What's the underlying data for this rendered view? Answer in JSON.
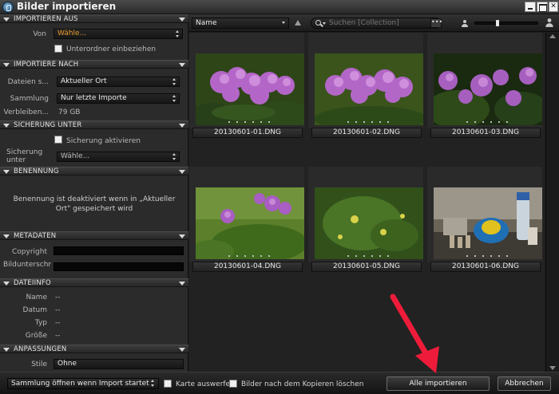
{
  "window": {
    "title": "Bilder importieren"
  },
  "left_panel": {
    "sections": {
      "importieren_aus": "IMPORTIEREN AUS",
      "importiere_nach": "IMPORTIERE NACH",
      "sicherung_unter": "SICHERUNG UNTER",
      "benennung": "BENENNUNG",
      "metadaten": "METADATEN",
      "dateiinfo": "DATEIINFO",
      "anpassungen": "ANPASSUNGEN"
    },
    "source": {
      "label": "Von",
      "value": "Wähle...",
      "subfolders_label": "Unterordner einbeziehen"
    },
    "destination": {
      "files_label": "Dateien s...",
      "files_value": "Aktueller Ort",
      "collection_label": "Sammlung",
      "collection_value": "Nur letzte Importe",
      "remaining_label": "Verbleiben...",
      "remaining_value": "79 GB"
    },
    "backup": {
      "activate_label": "Sicherung aktivieren",
      "location_label": "Sicherung unter",
      "location_value": "Wähle..."
    },
    "naming": {
      "message": "Benennung ist deaktiviert wenn in „Aktueller Ort\" gespeichert wird"
    },
    "metadata": {
      "copyright_label": "Copyright",
      "caption_label": "Bildunterschr"
    },
    "fileinfo": {
      "name_label": "Name",
      "name_value": "--",
      "date_label": "Datum",
      "date_value": "--",
      "type_label": "Typ",
      "type_value": "--",
      "size_label": "Größe",
      "size_value": "--"
    },
    "adjustments": {
      "styles_label": "Stile",
      "styles_value": "Ohne"
    }
  },
  "toolbar": {
    "sort_value": "Name",
    "search_placeholder": "Suchen [Collection]",
    "more_label": "•••"
  },
  "thumbnails": [
    {
      "filename": "20130601-01.DNG"
    },
    {
      "filename": "20130601-02.DNG"
    },
    {
      "filename": "20130601-03.DNG"
    },
    {
      "filename": "20130601-04.DNG"
    },
    {
      "filename": "20130601-05.DNG"
    },
    {
      "filename": "20130601-06.DNG"
    }
  ],
  "bottom_bar": {
    "open_collection_value": "Sammlung öffnen wenn Import startet",
    "eject_card_label": "Karte auswerfen",
    "delete_after_copy_label": "Bilder nach dem Kopieren löschen",
    "import_all_label": "Alle importieren",
    "cancel_label": "Abbrechen"
  },
  "colors": {
    "accent_orange": "#e59a2c",
    "annotation_arrow": "#ee1c3a",
    "panel_bg": "#2b2b2b",
    "grid_bg": "#222222"
  }
}
